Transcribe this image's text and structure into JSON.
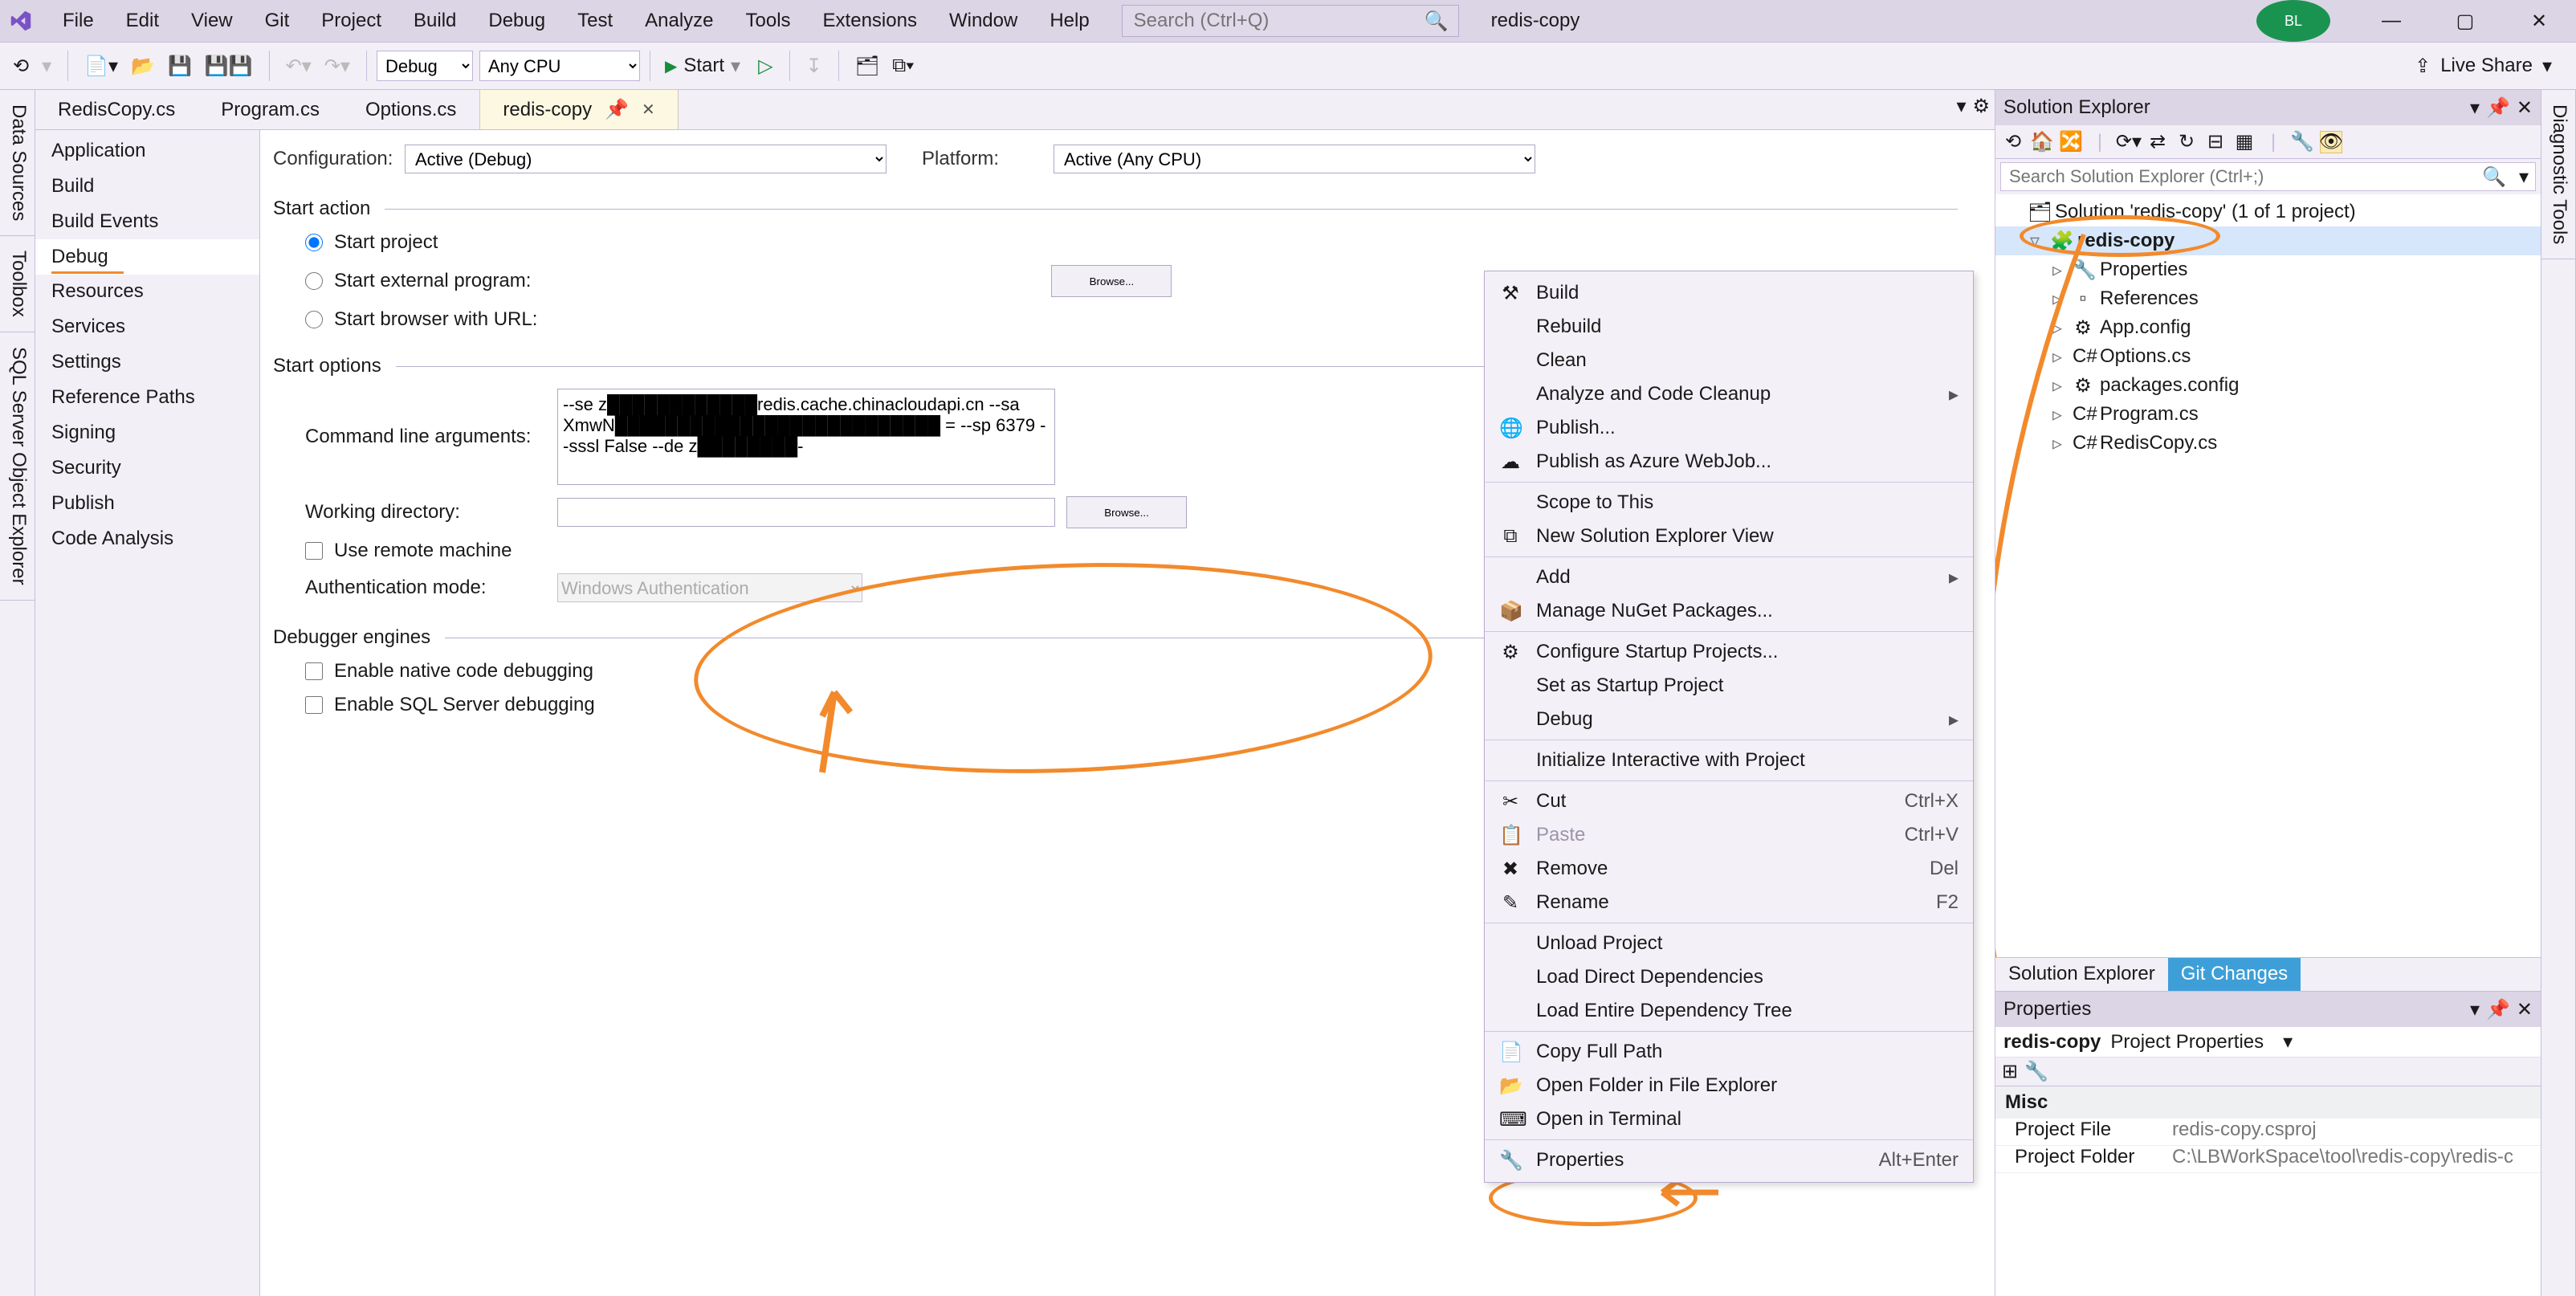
{
  "menubar": [
    "File",
    "Edit",
    "View",
    "Git",
    "Project",
    "Build",
    "Debug",
    "Test",
    "Analyze",
    "Tools",
    "Extensions",
    "Window",
    "Help"
  ],
  "search_placeholder": "Search (Ctrl+Q)",
  "solution_breadcrumb": "redis-copy",
  "avatar_initials": "BL",
  "toolbar": {
    "config_options": [
      "Debug"
    ],
    "platform_options": [
      "Any CPU"
    ],
    "start_label": "Start",
    "live_share": "Live Share"
  },
  "left_strip": [
    "Data Sources",
    "Toolbox",
    "SQL Server Object Explorer"
  ],
  "right_strip": [
    "Diagnostic Tools"
  ],
  "doc_tabs": [
    {
      "label": "RedisCopy.cs",
      "active": false
    },
    {
      "label": "Program.cs",
      "active": false
    },
    {
      "label": "Options.cs",
      "active": false
    },
    {
      "label": "redis-copy",
      "active": true,
      "pinned": true
    }
  ],
  "prop_nav": [
    "Application",
    "Build",
    "Build Events",
    "Debug",
    "Resources",
    "Services",
    "Settings",
    "Reference Paths",
    "Signing",
    "Security",
    "Publish",
    "Code Analysis"
  ],
  "prop_nav_selected": "Debug",
  "config": {
    "configuration_label": "Configuration:",
    "configuration_value": "Active (Debug)",
    "platform_label": "Platform:",
    "platform_value": "Active (Any CPU)"
  },
  "start_action": {
    "title": "Start action",
    "start_project": "Start project",
    "start_external": "Start external program:",
    "start_browser": "Start browser with URL:",
    "browse": "Browse..."
  },
  "start_options": {
    "title": "Start options",
    "cmd_label": "Command line arguments:",
    "cmd_value": "--se z████████████redis.cache.chinacloudapi.cn --sa XmwN██████████████████████████ = --sp 6379 --sssl False --de z████████-",
    "wd_label": "Working directory:",
    "wd_value": "",
    "browse": "Browse...",
    "remote": "Use remote machine",
    "auth_label": "Authentication mode:",
    "auth_value": "Windows Authentication"
  },
  "debugger_engines": {
    "title": "Debugger engines",
    "native": "Enable native code debugging",
    "sql": "Enable SQL Server debugging"
  },
  "solution_explorer": {
    "title": "Solution Explorer",
    "search_placeholder": "Search Solution Explorer (Ctrl+;)",
    "root": "Solution 'redis-copy' (1 of 1 project)",
    "project": "redis-copy",
    "children": [
      "Properties",
      "References",
      "App.config",
      "Options.cs",
      "packages.config",
      "Program.cs",
      "RedisCopy.cs"
    ],
    "bottom_tabs": [
      "Solution Explorer",
      "Git Changes"
    ]
  },
  "properties_panel": {
    "title": "Properties",
    "header_name": "redis-copy",
    "header_type": "Project Properties",
    "cat": "Misc",
    "rows": [
      {
        "k": "Project File",
        "v": "redis-copy.csproj"
      },
      {
        "k": "Project Folder",
        "v": "C:\\LBWorkSpace\\tool\\redis-copy\\redis-c"
      }
    ]
  },
  "context_menu": [
    {
      "icon": "build-icon",
      "label": "Build"
    },
    {
      "label": "Rebuild"
    },
    {
      "label": "Clean"
    },
    {
      "label": "Analyze and Code Cleanup",
      "sub": true
    },
    {
      "icon": "globe-icon",
      "label": "Publish..."
    },
    {
      "icon": "azure-icon",
      "label": "Publish as Azure WebJob..."
    },
    {
      "sep": true
    },
    {
      "label": "Scope to This"
    },
    {
      "icon": "sev-icon",
      "label": "New Solution Explorer View"
    },
    {
      "sep": true
    },
    {
      "label": "Add",
      "sub": true
    },
    {
      "icon": "nuget-icon",
      "label": "Manage NuGet Packages..."
    },
    {
      "sep": true
    },
    {
      "icon": "gear-icon",
      "label": "Configure Startup Projects..."
    },
    {
      "label": "Set as Startup Project"
    },
    {
      "label": "Debug",
      "sub": true
    },
    {
      "sep": true
    },
    {
      "label": "Initialize Interactive with Project"
    },
    {
      "sep": true
    },
    {
      "icon": "cut-icon",
      "label": "Cut",
      "shortcut": "Ctrl+X"
    },
    {
      "icon": "paste-icon",
      "label": "Paste",
      "shortcut": "Ctrl+V",
      "disabled": true
    },
    {
      "icon": "remove-icon",
      "label": "Remove",
      "shortcut": "Del"
    },
    {
      "icon": "rename-icon",
      "label": "Rename",
      "shortcut": "F2"
    },
    {
      "sep": true
    },
    {
      "label": "Unload Project"
    },
    {
      "label": "Load Direct Dependencies"
    },
    {
      "label": "Load Entire Dependency Tree"
    },
    {
      "sep": true
    },
    {
      "icon": "copy-icon",
      "label": "Copy Full Path"
    },
    {
      "icon": "open-folder-icon",
      "label": "Open Folder in File Explorer"
    },
    {
      "icon": "terminal-icon",
      "label": "Open in Terminal"
    },
    {
      "sep": true
    },
    {
      "icon": "wrench-icon",
      "label": "Properties",
      "shortcut": "Alt+Enter"
    }
  ]
}
